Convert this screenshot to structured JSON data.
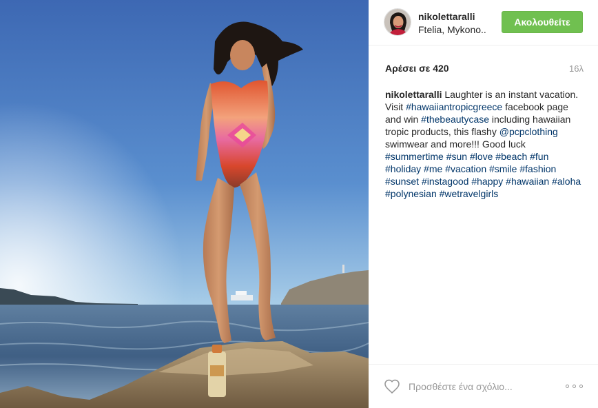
{
  "post": {
    "username": "nikolettaralli",
    "location": "Ftelia, Mykono..",
    "follow_label": "Ακολουθείτε",
    "likes_label": "Αρέσει σε",
    "likes_count": "420",
    "time_ago": "16λ",
    "caption": {
      "username": "nikolettaralli",
      "parts": [
        {
          "text": " Laughter is an instant vacation. Visit "
        },
        {
          "tag": "#hawaiiantropicgreece"
        },
        {
          "text": " facebook page and win "
        },
        {
          "tag": "#thebeautycase"
        },
        {
          "text": " including hawaiian tropic products, this flashy "
        },
        {
          "tag": "@pcpclothing"
        },
        {
          "text": " swimwear and more!!! Good luck "
        },
        {
          "tag": "#summertime"
        },
        {
          "text": " "
        },
        {
          "tag": "#sun"
        },
        {
          "text": " "
        },
        {
          "tag": "#love"
        },
        {
          "text": " "
        },
        {
          "tag": "#beach"
        },
        {
          "text": " "
        },
        {
          "tag": "#fun"
        },
        {
          "text": " "
        },
        {
          "tag": "#holiday"
        },
        {
          "text": " "
        },
        {
          "tag": "#me"
        },
        {
          "text": " "
        },
        {
          "tag": "#vacation"
        },
        {
          "text": " "
        },
        {
          "tag": "#smile"
        },
        {
          "text": " "
        },
        {
          "tag": "#fashion"
        },
        {
          "text": " "
        },
        {
          "tag": "#sunset"
        },
        {
          "text": " "
        },
        {
          "tag": "#instagood"
        },
        {
          "text": " "
        },
        {
          "tag": "#happy"
        },
        {
          "text": " "
        },
        {
          "tag": "#hawaiian"
        },
        {
          "text": " "
        },
        {
          "tag": "#aloha"
        },
        {
          "text": " "
        },
        {
          "tag": "#polynesian"
        },
        {
          "text": " "
        },
        {
          "tag": "#wetravelgirls"
        }
      ]
    },
    "comment_placeholder": "Προσθέστε ένα σχόλιο...",
    "icons": {
      "like": "heart-outline-icon",
      "more": "more-options-icon"
    },
    "colors": {
      "follow_button": "#70c050",
      "hashtag": "#003569",
      "muted": "#999999"
    }
  }
}
